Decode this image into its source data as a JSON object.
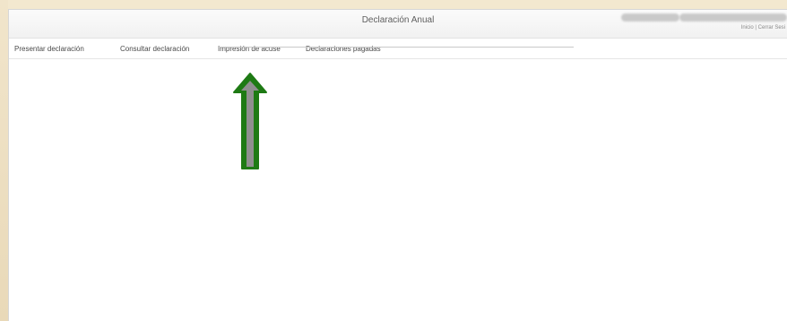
{
  "window": {
    "title": "Declaración Anual",
    "user_links": "Inicio | Cerrar Sesi"
  },
  "menu": {
    "items": [
      {
        "label": "Presentar declaración"
      },
      {
        "label": "Consultar declaración"
      },
      {
        "label": "Impresión de acuse"
      },
      {
        "label": "Declaraciones pagadas"
      }
    ]
  },
  "annotation": {
    "arrow_icon": "up-arrow-icon",
    "colors": {
      "arrow_outline": "#1e7a14",
      "arrow_fill": "#8f8f8f"
    }
  }
}
